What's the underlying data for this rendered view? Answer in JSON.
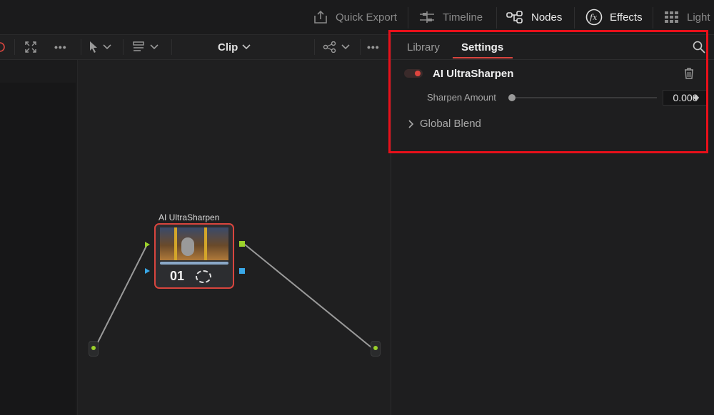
{
  "topbar": {
    "pages": [
      {
        "label": "Quick Export",
        "icon": "export-icon"
      },
      {
        "label": "Timeline",
        "icon": "timeline-icon"
      },
      {
        "label": "Nodes",
        "icon": "nodes-icon",
        "active": true
      },
      {
        "label": "Effects",
        "icon": "fx-icon",
        "active": true
      },
      {
        "label": "Light",
        "icon": "lightbox-icon"
      }
    ]
  },
  "toolbar": {
    "clip_label": "Clip"
  },
  "node_graph": {
    "node": {
      "label": "AI UltraSharpen",
      "number": "01"
    }
  },
  "right_panel": {
    "tabs": [
      {
        "label": "Library"
      },
      {
        "label": "Settings",
        "active": true
      }
    ],
    "effect": {
      "title": "AI UltraSharpen",
      "param_label": "Sharpen Amount",
      "param_value": "0.000",
      "section": "Global Blend"
    }
  },
  "colors": {
    "accent": "#d9453e",
    "highlight": "#e8101a",
    "node_connector": "#9bd12a"
  }
}
